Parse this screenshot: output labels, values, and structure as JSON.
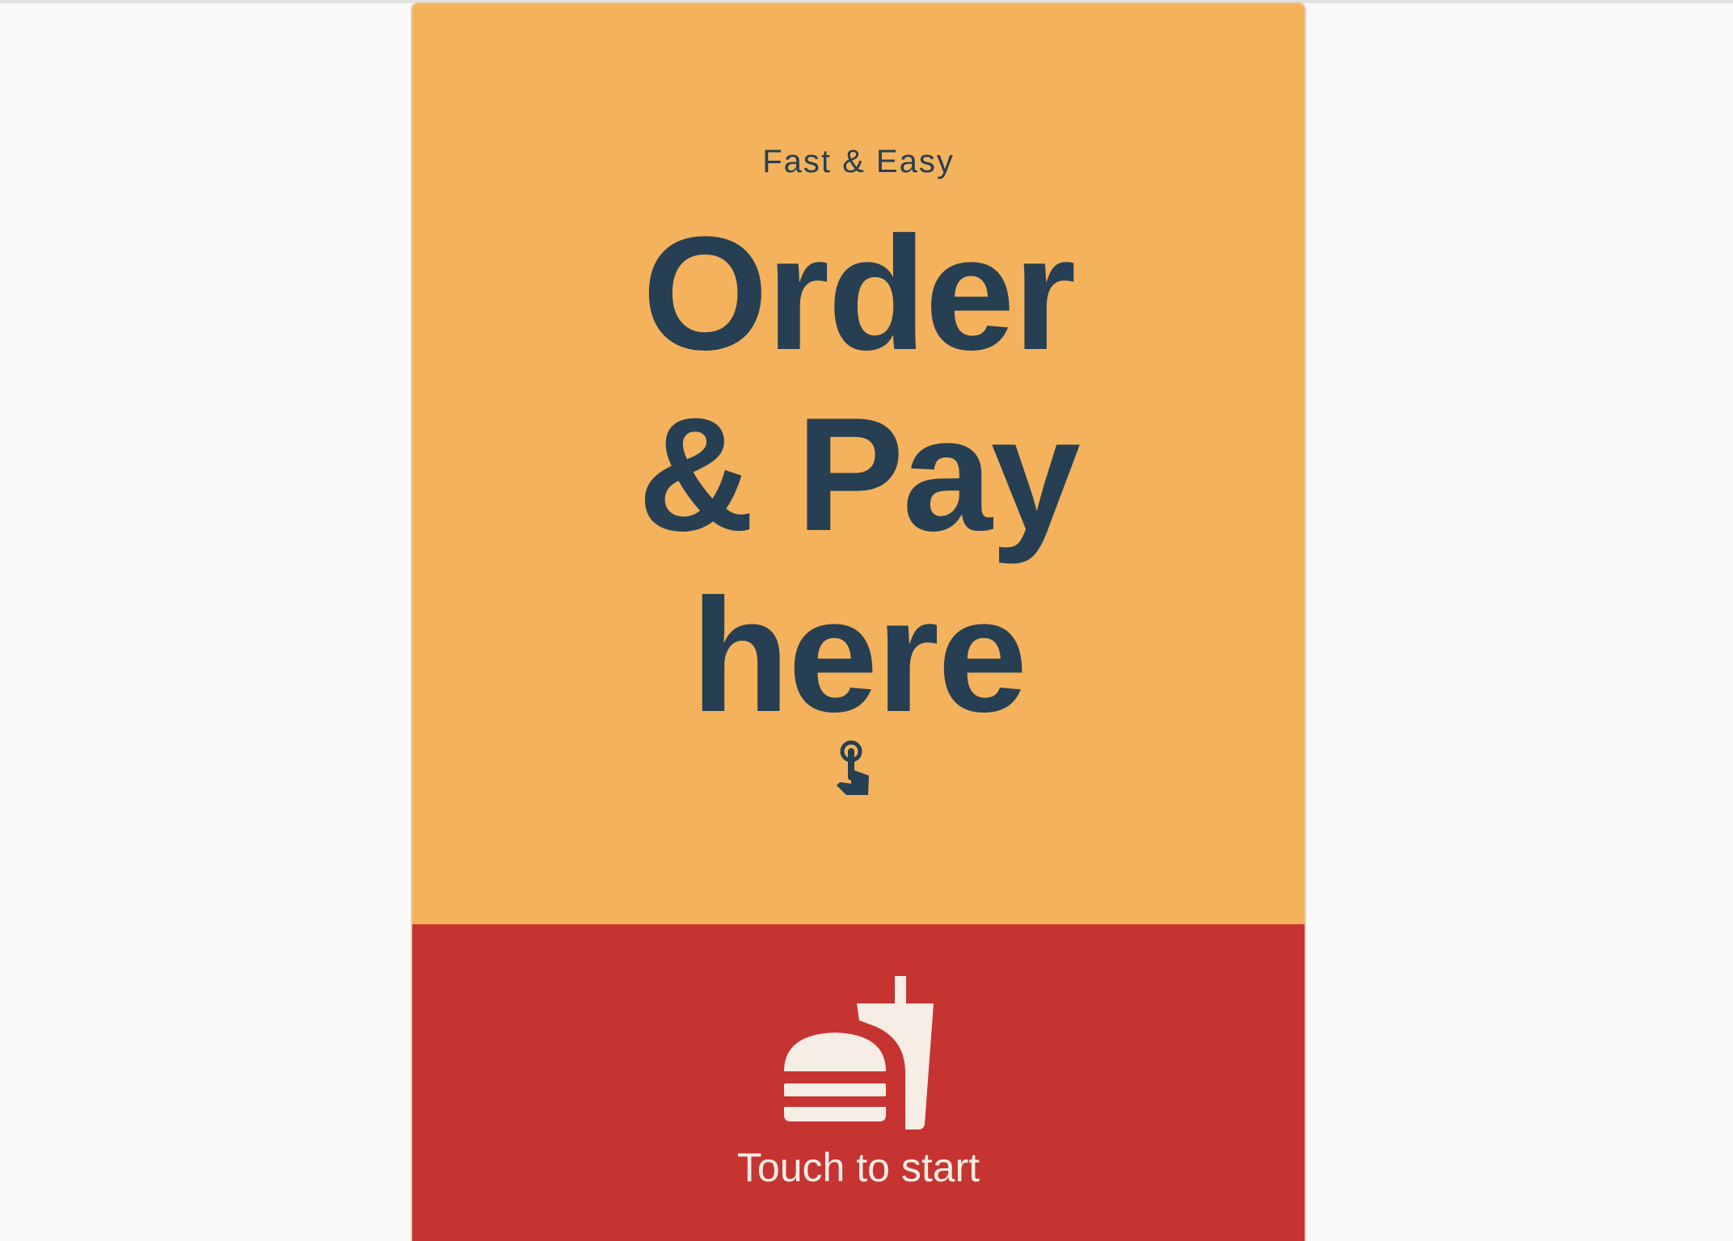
{
  "hero": {
    "tagline": "Fast & Easy",
    "headline_lines": [
      "Order",
      "& Pay",
      "here"
    ],
    "background_color": "#f4b25c",
    "text_color": "#263f53",
    "icon": "tap-finger-icon"
  },
  "start": {
    "label": "Touch to start",
    "background_color": "#c63432",
    "text_color": "#f6ede4",
    "icon": "burger-and-drink-icon"
  }
}
